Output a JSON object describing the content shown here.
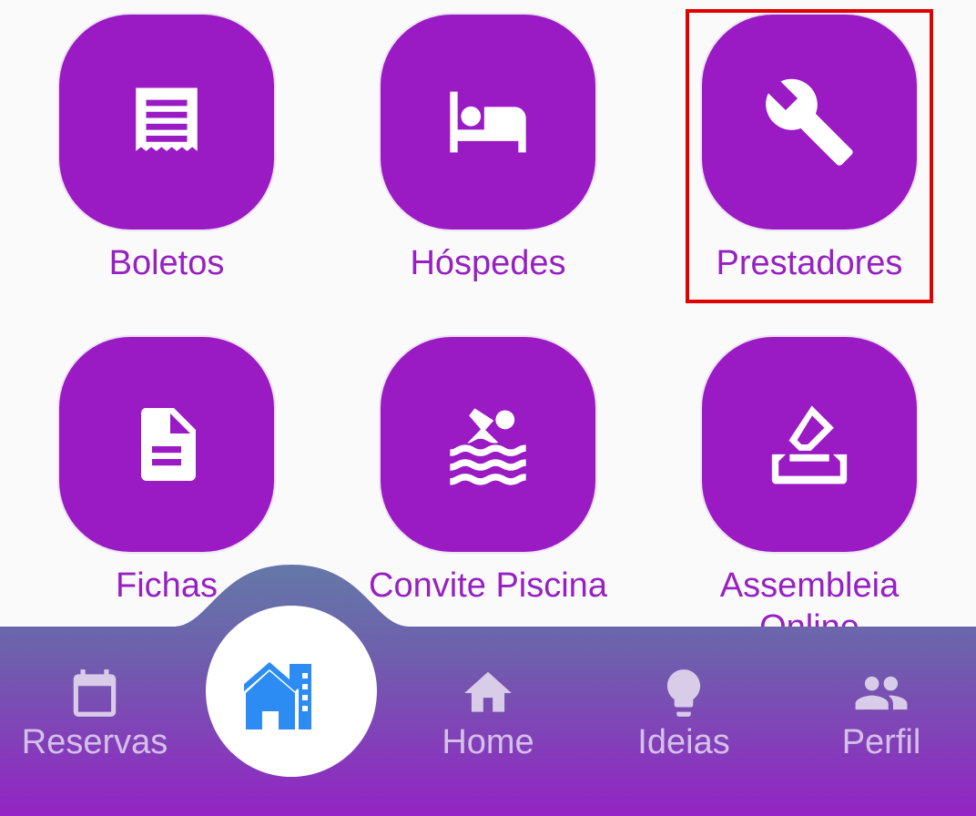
{
  "grid": {
    "tiles": [
      {
        "label": "Boletos",
        "icon": "receipt-icon"
      },
      {
        "label": "Hóspedes",
        "icon": "bed-icon"
      },
      {
        "label": "Prestadores",
        "icon": "wrench-icon"
      },
      {
        "label": "Fichas",
        "icon": "document-icon"
      },
      {
        "label": "Convite Piscina",
        "icon": "swimmer-icon"
      },
      {
        "label": "Assembleia Online",
        "icon": "ballot-box-icon"
      }
    ]
  },
  "bottom_nav": {
    "reservas": {
      "label": "Reservas",
      "icon": "calendar-icon"
    },
    "center": {
      "icon": "condominium-icon"
    },
    "home": {
      "label": "Home",
      "icon": "home-icon"
    },
    "ideias": {
      "label": "Ideias",
      "icon": "lightbulb-icon"
    },
    "perfil": {
      "label": "Perfil",
      "icon": "people-icon"
    }
  },
  "colors": {
    "tile": "#9a1ac4",
    "tile_label": "#9720c2",
    "highlight": "#e00000",
    "nav_top": "#6478a8",
    "nav_bottom": "#9424c4",
    "fab_icon": "#2c8cf4"
  }
}
